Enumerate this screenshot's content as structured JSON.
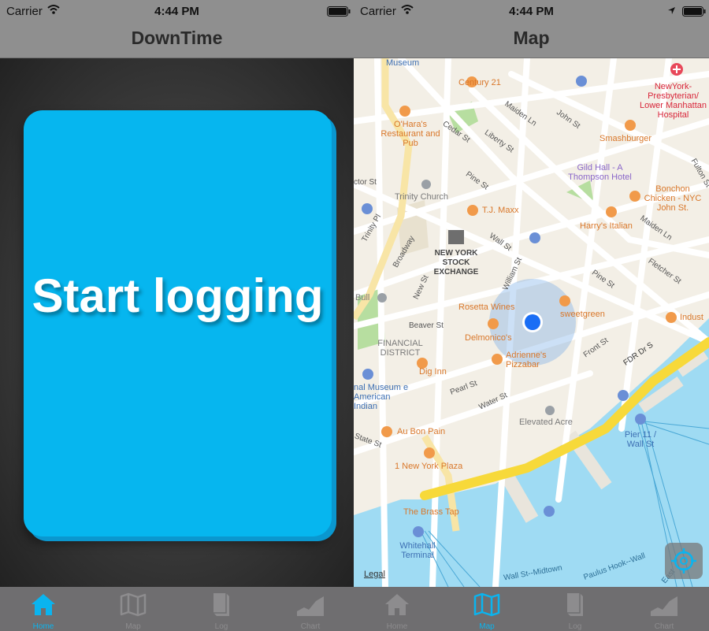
{
  "left_screen": {
    "status": {
      "carrier": "Carrier",
      "time": "4:44 PM"
    },
    "nav_title": "DownTime",
    "start_button_label": "Start logging",
    "tabs": [
      {
        "label": "Home",
        "icon": "home-icon",
        "active": true
      },
      {
        "label": "Map",
        "icon": "map-icon",
        "active": false
      },
      {
        "label": "Log",
        "icon": "book-icon",
        "active": false
      },
      {
        "label": "Chart",
        "icon": "chart-icon",
        "active": false
      }
    ]
  },
  "right_screen": {
    "status": {
      "carrier": "Carrier",
      "time": "4:44 PM"
    },
    "nav_title": "Map",
    "map": {
      "legal": "Legal",
      "places": {
        "museum": "Museum",
        "century21": "Century 21",
        "nyp": "NewYork-Presbyterian/ Lower Manhattan Hospital",
        "oharas": "O'Hara's Restaurant and Pub",
        "smashburger": "Smashburger",
        "gildhall": "Gild Hall - A Thompson Hotel",
        "trinity": "Trinity Church",
        "tjmaxx": "T.J. Maxx",
        "bonchon": "Bonchon Chicken - NYC John St.",
        "harrys": "Harry's Italian",
        "nyse": "NEW YORK STOCK EXCHANGE",
        "rosetta": "Rosetta Wines",
        "sweetgreen": "sweetgreen",
        "delmonicos": "Delmonico's",
        "adriennes": "Adrienne's Pizzabar",
        "financial": "FINANCIAL DISTRICT",
        "diginn": "Dig Inn",
        "museum_indian": "nal Museum e American Indian",
        "elevated": "Elevated Acre",
        "aubonpain": "Au Bon Pain",
        "nyplaza": "1 New York Plaza",
        "pier11": "Pier 11 / Wall St",
        "brasstap": "The Brass Tap",
        "whitehall": "Whitehall Terminal",
        "industry": "Indust",
        "bull": "Bull"
      },
      "streets": {
        "maiden": "Maiden Ln",
        "liberty": "Liberty St",
        "cedar": "Cedar St",
        "john": "John St",
        "pine": "Pine St",
        "wall": "Wall St",
        "broadway": "Broadway",
        "trinitypl": "Trinity Pl",
        "rector": "ctor St",
        "william": "William St",
        "beaver": "Beaver St",
        "new": "New St",
        "pearl": "Pearl St",
        "water": "Water St",
        "front": "Front St",
        "fdr": "FDR Dr S",
        "fletcher": "Fletcher St",
        "fulton": "Fulton St",
        "state": "State St",
        "wall_midtown": "Wall St--Midtown",
        "paulus": "Paulus Hook--Wall",
        "east": "East"
      }
    },
    "tabs": [
      {
        "label": "Home",
        "icon": "home-icon",
        "active": false
      },
      {
        "label": "Map",
        "icon": "map-icon",
        "active": true
      },
      {
        "label": "Log",
        "icon": "book-icon",
        "active": false
      },
      {
        "label": "Chart",
        "icon": "chart-icon",
        "active": false
      }
    ]
  },
  "colors": {
    "accent": "#0ab4ef",
    "button": "#06b6ef",
    "bar": "#8f8f8f",
    "tabbar": "#6f6e70",
    "water": "#9fdbf3",
    "highway": "#f7d93a"
  }
}
